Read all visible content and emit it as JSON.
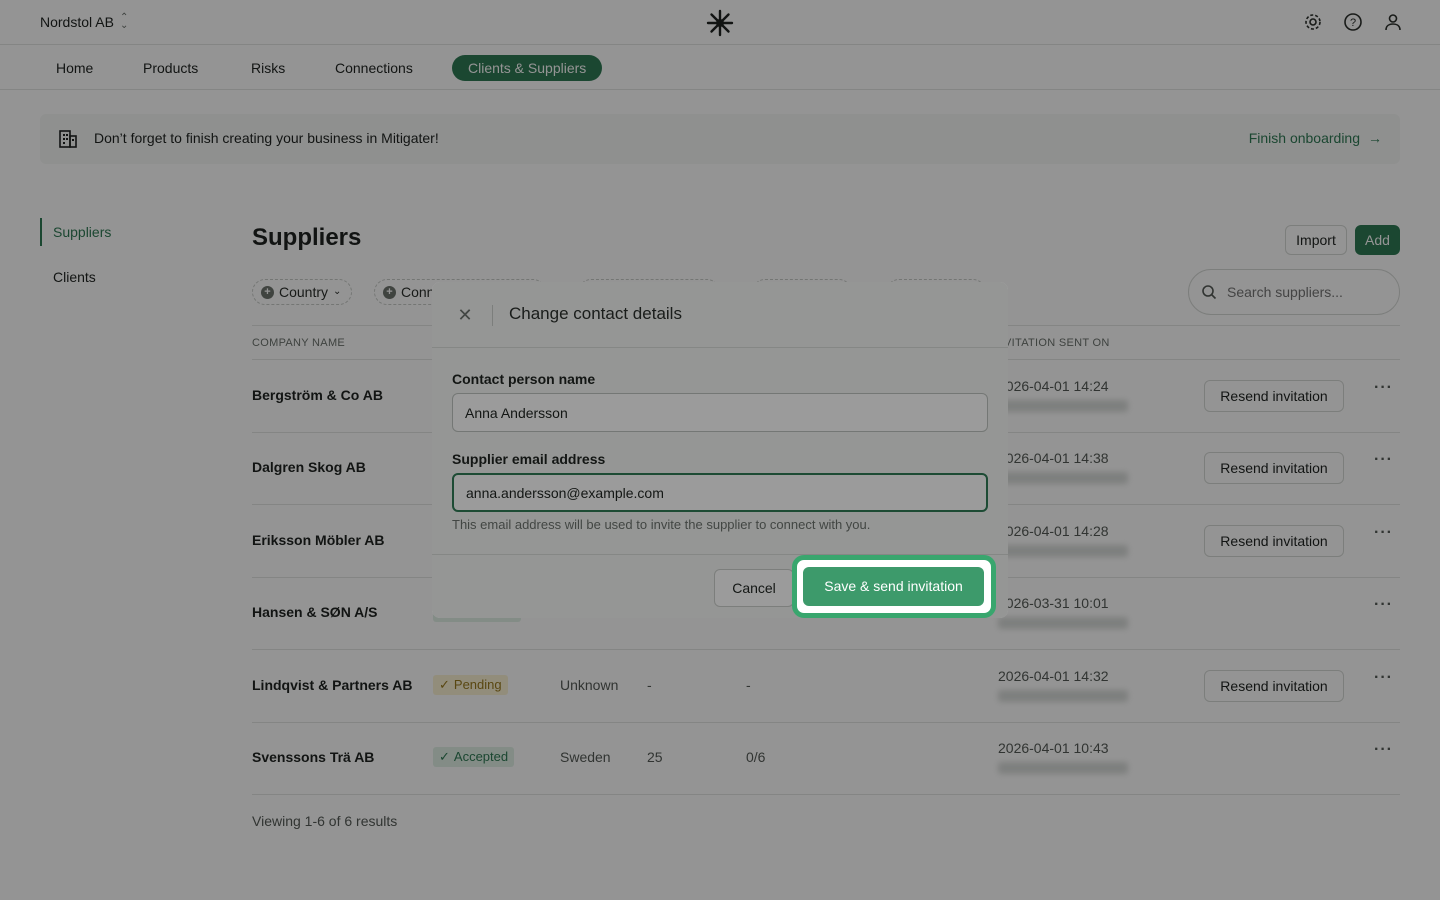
{
  "header": {
    "org_name": "Nordstol AB",
    "icons": [
      "settings-icon",
      "help-icon",
      "user-icon"
    ]
  },
  "nav": {
    "items": [
      {
        "label": "Home"
      },
      {
        "label": "Products"
      },
      {
        "label": "Risks"
      },
      {
        "label": "Connections"
      },
      {
        "label": "Clients & Suppliers",
        "active": true
      }
    ]
  },
  "banner": {
    "text": "Don’t forget to finish creating your business in Mitigater!",
    "link": "Finish onboarding"
  },
  "side_nav": {
    "items": [
      {
        "label": "Suppliers",
        "active": true
      },
      {
        "label": "Clients"
      }
    ]
  },
  "main": {
    "title": "Suppliers",
    "import_label": "Import",
    "add_label": "Add",
    "filters": [
      "Country",
      "Conn"
    ],
    "search_placeholder": "Search suppliers...",
    "columns": {
      "company_name": "COMPANY NAME",
      "invitation_sent_on": "VITATION SENT ON"
    },
    "rows": [
      {
        "name": "Bergström & Co AB",
        "status": "",
        "country": "",
        "employees": "",
        "progress": "",
        "date": "2026-04-01 14:24",
        "resend": "Resend invitation"
      },
      {
        "name": "Dalgren Skog AB",
        "status": "",
        "country": "",
        "employees": "",
        "progress": "",
        "date": "2026-04-01 14:38",
        "resend": "Resend invitation"
      },
      {
        "name": "Eriksson Möbler AB",
        "status": "",
        "country": "",
        "employees": "",
        "progress": "",
        "date": "2026-04-01 14:28",
        "resend": "Resend invitation"
      },
      {
        "name": "Hansen & SØN A/S",
        "status": "",
        "country": "",
        "employees": "",
        "progress": "",
        "date": "2026-03-31 10:01",
        "resend": ""
      },
      {
        "name": "Lindqvist & Partners AB",
        "status": "Pending",
        "country": "Unknown",
        "employees": "-",
        "progress": "-",
        "date": "2026-04-01 14:32",
        "resend": "Resend invitation"
      },
      {
        "name": "Svenssons Trä AB",
        "status": "Accepted",
        "country": "Sweden",
        "employees": "25",
        "progress": "0/6",
        "date": "2026-04-01 10:43",
        "resend": ""
      }
    ],
    "footer_count": "Viewing 1-6 of 6 results"
  },
  "modal": {
    "title": "Change contact details",
    "contact_label": "Contact person name",
    "contact_value": "Anna Andersson",
    "email_label": "Supplier email address",
    "email_value": "anna.andersson@example.com",
    "hint": "This email address will be used to invite the supplier to connect with you.",
    "cancel_label": "Cancel",
    "submit_label": "Save & send invitation"
  },
  "colors": {
    "brand": "#2f7a55",
    "cta": "#3d9a6b",
    "cta_ring": "#39a66e",
    "pending_bg": "#fbf3d4",
    "accepted_bg": "#e2f2e7"
  }
}
